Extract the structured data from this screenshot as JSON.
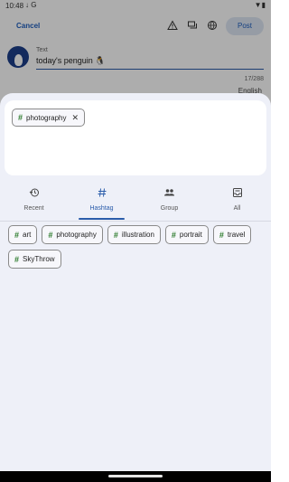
{
  "status_bar": {
    "time": "10:48",
    "left_icons": "↓ G",
    "right_icons": "▼▮"
  },
  "top_bar": {
    "cancel_label": "Cancel",
    "post_label": "Post",
    "icons": [
      "warning-icon",
      "chat-icon",
      "globe-icon"
    ]
  },
  "compose": {
    "field_label": "Text",
    "field_value": "today's penguin 🐧",
    "char_count": "17/288",
    "language": "English"
  },
  "sheet": {
    "selected_tags": [
      {
        "label": "photography"
      }
    ],
    "tabs": [
      {
        "label": "Recent",
        "icon": "history-icon"
      },
      {
        "label": "Hashtag",
        "icon": "hashtag-icon",
        "active": true
      },
      {
        "label": "Group",
        "icon": "group-icon"
      },
      {
        "label": "All",
        "icon": "inbox-icon"
      }
    ],
    "tags": [
      "art",
      "photography",
      "illustration",
      "portrait",
      "travel",
      "SkyThrow"
    ]
  },
  "colors": {
    "accent": "#2a5caa",
    "hash": "#2a7a2a",
    "sheet_bg": "#eef0f8"
  }
}
